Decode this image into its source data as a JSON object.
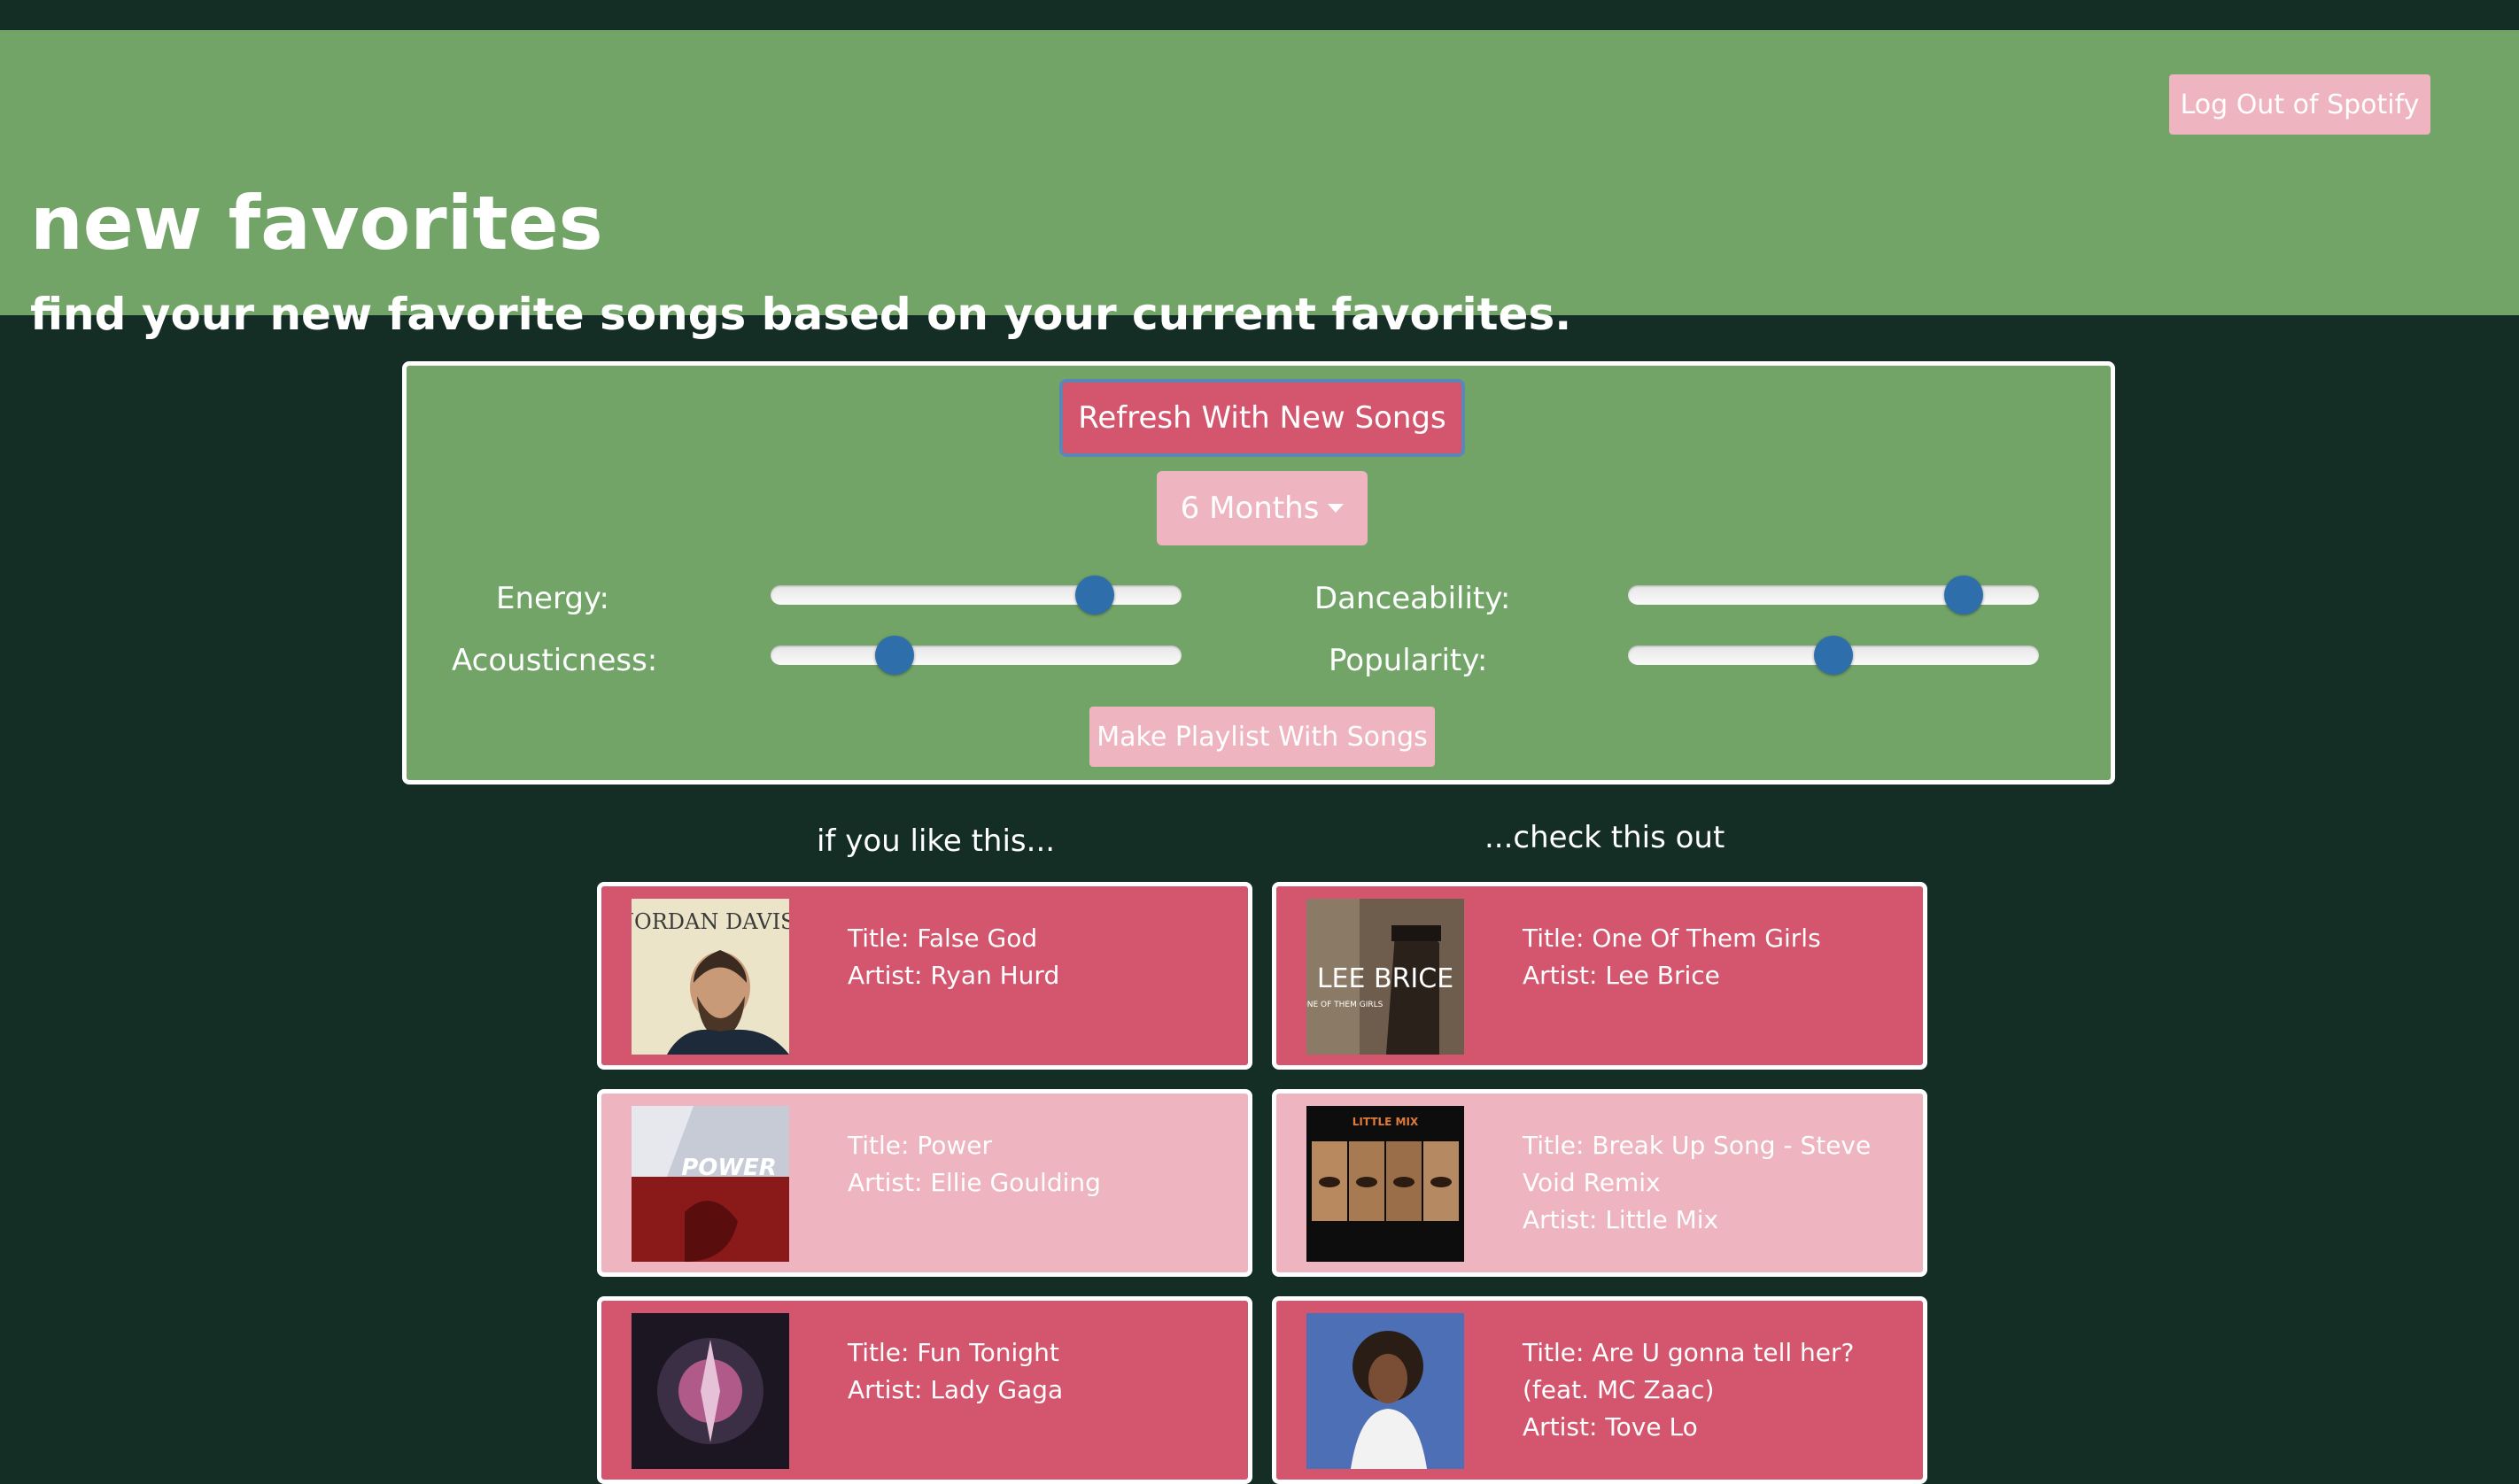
{
  "header": {
    "logout_label": "Log Out of Spotify",
    "title": "new favorites",
    "subtitle": "find your new favorite songs based on your current favorites."
  },
  "controls": {
    "refresh_label": "Refresh With New Songs",
    "time_range": "6 Months",
    "playlist_label": "Make Playlist With Songs",
    "sliders": [
      {
        "label": "Energy:",
        "value": 0.82
      },
      {
        "label": "Danceability:",
        "value": 0.85
      },
      {
        "label": "Acousticness:",
        "value": 0.28
      },
      {
        "label": "Popularity:",
        "value": 0.5
      }
    ]
  },
  "columns": {
    "left_header": "if you like this...",
    "right_header": "...check this out"
  },
  "songs_left": [
    {
      "title": "Title: False God",
      "artist": "Artist: Ryan Hurd",
      "cover_text": "JORDAN DAVIS"
    },
    {
      "title": "Title: Power",
      "artist": "Artist: Ellie Goulding",
      "cover_text": "POWER"
    },
    {
      "title": "Title: Fun Tonight",
      "artist": "Artist: Lady Gaga",
      "cover_text": ""
    }
  ],
  "songs_right": [
    {
      "title": "Title: One Of Them Girls",
      "artist": "Artist: Lee Brice",
      "cover_text": "LEE BRICE"
    },
    {
      "title": "Title: Break Up Song - Steve Void Remix",
      "artist": "Artist: Little Mix",
      "cover_text": "LITTLE MIX"
    },
    {
      "title": "Title: Are U gonna tell her? (feat. MC Zaac)",
      "artist": "Artist: Tove Lo",
      "cover_text": ""
    }
  ],
  "colors": {
    "background": "#142e25",
    "header_green": "#72a468",
    "card_dark_pink": "#d4566e",
    "card_light_pink": "#eeb4bf",
    "slider_thumb": "#2e6fab"
  }
}
